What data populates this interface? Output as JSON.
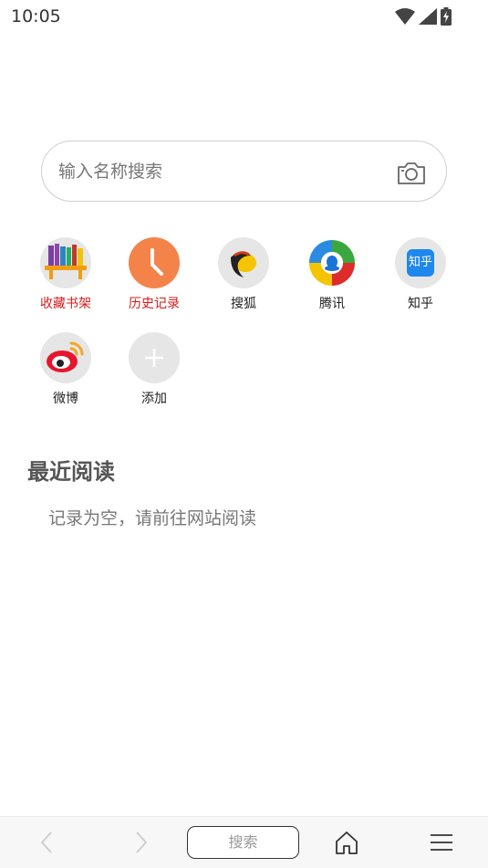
{
  "status_bar": {
    "time": "10:05",
    "icons": [
      "wifi-icon",
      "cellular-signal-icon",
      "battery-charging-icon"
    ]
  },
  "search": {
    "placeholder": "输入名称搜索",
    "camera_icon": "camera-icon"
  },
  "shortcuts": [
    {
      "label": "收藏书架",
      "icon": "bookshelf-icon",
      "highlight": true
    },
    {
      "label": "历史记录",
      "icon": "clock-icon",
      "highlight": true
    },
    {
      "label": "搜狐",
      "icon": "sohu-logo-icon",
      "highlight": false
    },
    {
      "label": "腾讯",
      "icon": "tencent-logo-icon",
      "highlight": false
    },
    {
      "label": "知乎",
      "icon": "zhihu-logo-icon",
      "highlight": false,
      "logo_text": "知乎"
    },
    {
      "label": "微博",
      "icon": "weibo-logo-icon",
      "highlight": false
    },
    {
      "label": "添加",
      "icon": "plus-icon",
      "highlight": false
    }
  ],
  "recent": {
    "title": "最近阅读",
    "empty_message": "记录为空，请前往网站阅读"
  },
  "bottom_bar": {
    "back_icon": "chevron-left-icon",
    "forward_icon": "chevron-right-icon",
    "search_label": "搜索",
    "home_icon": "home-icon",
    "menu_icon": "menu-icon"
  },
  "colors": {
    "highlight_label": "#d41c1c",
    "clock_orange": "#f4834a",
    "icon_bg": "#e6e6e6",
    "zhihu_blue": "#1e88ee"
  }
}
